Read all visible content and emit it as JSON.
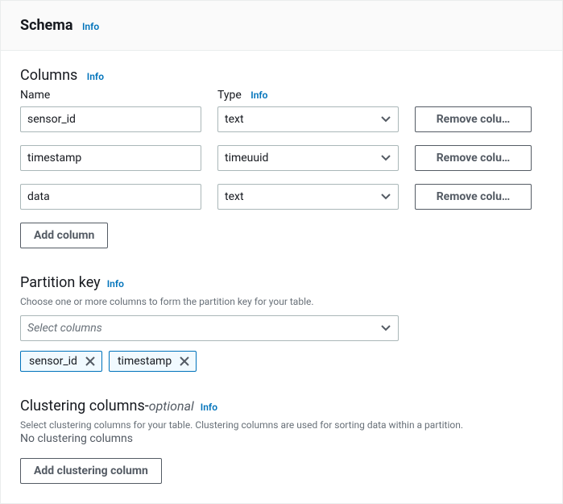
{
  "header": {
    "title": "Schema",
    "info": "Info"
  },
  "columns": {
    "title": "Columns",
    "info": "Info",
    "name_label": "Name",
    "type_label": "Type",
    "type_info": "Info",
    "rows": [
      {
        "name": "sensor_id",
        "type": "text",
        "remove_label": "Remove colu…"
      },
      {
        "name": "timestamp",
        "type": "timeuuid",
        "remove_label": "Remove colu…"
      },
      {
        "name": "data",
        "type": "text",
        "remove_label": "Remove colu…"
      }
    ],
    "add_label": "Add column"
  },
  "partition": {
    "title": "Partition key",
    "info": "Info",
    "help": "Choose one or more columns to form the partition key for your table.",
    "select_placeholder": "Select columns",
    "tags": [
      "sensor_id",
      "timestamp"
    ]
  },
  "clustering": {
    "title": "Clustering columns",
    "dash": " - ",
    "optional": "optional",
    "info": "Info",
    "help": "Select clustering columns for your table. Clustering columns are used for sorting data within a partition.",
    "empty_text": "No clustering columns",
    "add_label": "Add clustering column"
  }
}
